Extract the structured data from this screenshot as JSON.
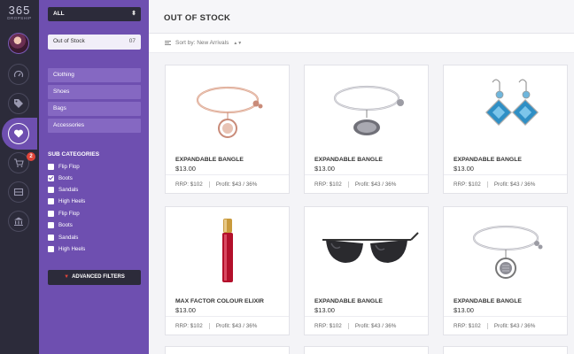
{
  "logo": {
    "number": "365",
    "subtitle": "DROPSHIP"
  },
  "rail": {
    "cart_badge": "2"
  },
  "sidebar": {
    "select_value": "ALL",
    "active_filter": {
      "label": "Out of Stock",
      "count": "07"
    },
    "categories": [
      "Clothing",
      "Shoes",
      "Bags",
      "Accessories"
    ],
    "sub_title": "SUB CATEGORIES",
    "sub_items": [
      {
        "label": "Flip Flop",
        "checked": false
      },
      {
        "label": "Boots",
        "checked": true
      },
      {
        "label": "Sandals",
        "checked": false
      },
      {
        "label": "High Heels",
        "checked": false
      },
      {
        "label": "Flip Flop",
        "checked": false
      },
      {
        "label": "Boots",
        "checked": false
      },
      {
        "label": "Sandals",
        "checked": false
      },
      {
        "label": "High Heels",
        "checked": false
      }
    ],
    "advanced_filters": "ADVANCED FILTERS"
  },
  "main": {
    "title": "OUT OF STOCK",
    "sort_label": "Sort by: New Arrivals"
  },
  "products": [
    {
      "name": "EXPANDABLE BANGLE",
      "price": "$13.00",
      "rrp": "RRP: $102",
      "profit": "Profit: $43 / 36%",
      "image": "rose-gold-bangle"
    },
    {
      "name": "EXPANDABLE BANGLE",
      "price": "$13.00",
      "rrp": "RRP: $102",
      "profit": "Profit: $43 / 36%",
      "image": "silver-bangle-oval-charm"
    },
    {
      "name": "EXPANDABLE BANGLE",
      "price": "$13.00",
      "rrp": "RRP: $102",
      "profit": "Profit: $43 / 36%",
      "image": "blue-gem-earrings"
    },
    {
      "name": "MAX FACTOR COLOUR ELIXIR",
      "price": "$13.00",
      "rrp": "RRP: $102",
      "profit": "Profit: $43 / 36%",
      "image": "lip-gloss"
    },
    {
      "name": "EXPANDABLE BANGLE",
      "price": "$13.00",
      "rrp": "RRP: $102",
      "profit": "Profit: $43 / 36%",
      "image": "sunglasses"
    },
    {
      "name": "EXPANDABLE BANGLE",
      "price": "$13.00",
      "rrp": "RRP: $102",
      "profit": "Profit: $43 / 36%",
      "image": "silver-bangle-round-charm"
    }
  ],
  "colors": {
    "rail": "#2c2b3a",
    "sidebar": "#6e4fb0",
    "sidebar_item": "#8568c2",
    "badge": "#e0453a"
  }
}
